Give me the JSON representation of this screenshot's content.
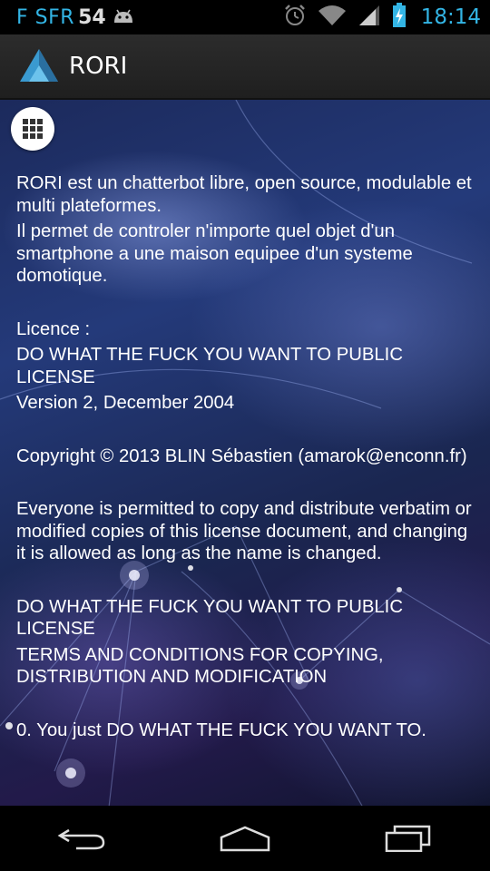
{
  "status_bar": {
    "carrier": "F SFR",
    "notification_count": "54",
    "time": "18:14",
    "icons": [
      "android-icon",
      "alarm-icon",
      "wifi-icon",
      "signal-icon",
      "battery-icon"
    ]
  },
  "action_bar": {
    "title": "RORI",
    "logo_icon": "rori-logo-icon"
  },
  "menu_button": {
    "icon": "grid-icon"
  },
  "content": {
    "intro_line1": "RORI est un chatterbot libre, open source, modulable et multi plateformes.",
    "intro_line2": "Il permet de controler n'importe quel objet d'un smartphone a une maison equipee d'un systeme domotique.",
    "licence_label": "Licence :",
    "licence_name": "DO WHAT THE FUCK YOU WANT TO PUBLIC LICENSE",
    "licence_version": "Version 2, December 2004",
    "copyright": "Copyright © 2013 BLIN Sébastien (amarok@enconn.fr)",
    "permission": "Everyone is permitted to copy and distribute verbatim or modified copies of this license document, and changing it is allowed as long as the name is changed.",
    "terms_title": "DO WHAT THE FUCK YOU WANT TO PUBLIC LICENSE",
    "terms_subtitle": "TERMS AND CONDITIONS FOR COPYING, DISTRIBUTION AND MODIFICATION",
    "term0": "0. You just DO WHAT THE FUCK YOU WANT TO."
  },
  "nav_bar": {
    "icons": [
      "back-icon",
      "home-icon",
      "recent-apps-icon"
    ]
  },
  "colors": {
    "status_accent": "#33b5e5",
    "action_bar": "#262626",
    "text": "#ffffff"
  }
}
